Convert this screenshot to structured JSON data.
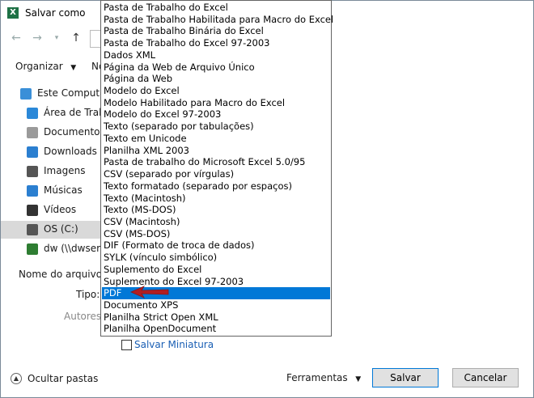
{
  "window": {
    "title": "Salvar como"
  },
  "toolbar": {
    "organize_label": "Organizar",
    "novo_label": "No"
  },
  "sidebar": {
    "items": [
      {
        "label": "Este Computad",
        "icon": "computer-icon",
        "color": "#3a8fd8"
      },
      {
        "label": "Área de Traba",
        "icon": "desktop-icon",
        "color": "#2b88d8"
      },
      {
        "label": "Documentos",
        "icon": "documents-icon",
        "color": "#9a9a9a"
      },
      {
        "label": "Downloads",
        "icon": "download-icon",
        "color": "#2b7fd0"
      },
      {
        "label": "Imagens",
        "icon": "pictures-icon",
        "color": "#555"
      },
      {
        "label": "Músicas",
        "icon": "music-icon",
        "color": "#2b7fd0"
      },
      {
        "label": "Vídeos",
        "icon": "videos-icon",
        "color": "#333"
      },
      {
        "label": "OS (C:)",
        "icon": "drive-icon",
        "color": "#555"
      },
      {
        "label": "dw (\\\\dwserve",
        "icon": "network-drive-icon",
        "color": "#2e7d32"
      }
    ]
  },
  "form": {
    "filename_label": "Nome do arquivo:",
    "type_label": "Tipo:",
    "authors_label": "Autores:",
    "thumbnail_label": "Salvar Miniatura"
  },
  "file_types": [
    "Pasta de Trabalho do Excel",
    "Pasta de Trabalho Habilitada para Macro do Excel",
    "Pasta de Trabalho Binária do Excel",
    "Pasta de Trabalho do Excel 97-2003",
    "Dados XML",
    "Página da Web de Arquivo Único",
    "Página da Web",
    "Modelo do Excel",
    "Modelo Habilitado para Macro do Excel",
    "Modelo do Excel 97-2003",
    "Texto (separado por tabulações)",
    "Texto em Unicode",
    "Planilha XML 2003",
    "Pasta de trabalho do Microsoft Excel 5.0/95",
    "CSV (separado por vírgulas)",
    "Texto formatado (separado por espaços)",
    "Texto (Macintosh)",
    "Texto (MS-DOS)",
    "CSV (Macintosh)",
    "CSV (MS-DOS)",
    "DIF (Formato de troca de dados)",
    "SYLK (vínculo simbólico)",
    "Suplemento do Excel",
    "Suplemento do Excel 97-2003",
    "PDF",
    "Documento XPS",
    "Planilha Strict Open XML",
    "Planilha OpenDocument"
  ],
  "selected_type": "PDF",
  "footer": {
    "hide_folders_label": "Ocultar pastas",
    "tools_label": "Ferramentas",
    "save_label": "Salvar",
    "cancel_label": "Cancelar"
  },
  "colors": {
    "selection": "#0078d7",
    "arrow": "#b01e23"
  }
}
